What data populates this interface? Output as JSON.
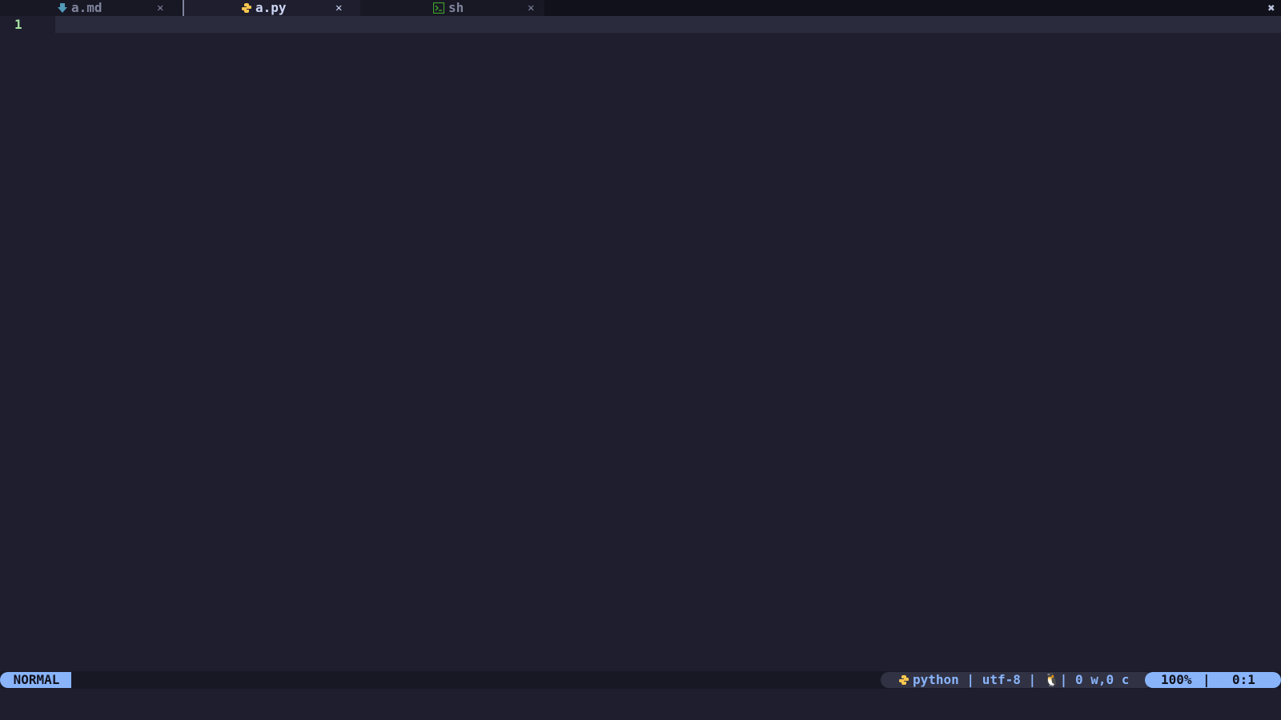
{
  "tabline": {
    "tabs": [
      {
        "label": "a.md",
        "icon": "markdown-icon",
        "active": false,
        "close": "✕"
      },
      {
        "label": "a.py",
        "icon": "python-icon",
        "active": true,
        "close": "✕"
      },
      {
        "label": "sh",
        "icon": "terminal-icon",
        "active": false,
        "close": "✕"
      }
    ],
    "close_all": "✖"
  },
  "editor": {
    "line_numbers": [
      "1"
    ],
    "content": ""
  },
  "statusline": {
    "mode": "NORMAL",
    "filetype_icon": "python-icon",
    "info": "python | utf-8 | 🐧| 0 w,0 c",
    "percent": "100%",
    "separator": "|",
    "cursor": "0:1"
  },
  "colors": {
    "background": "#1e1e2e",
    "accent": "#89b4fa",
    "line_number": "#a6e3a1",
    "python_icon": "#f9c74f",
    "markdown_icon": "#519aba",
    "terminal_icon": "#40a02b"
  }
}
